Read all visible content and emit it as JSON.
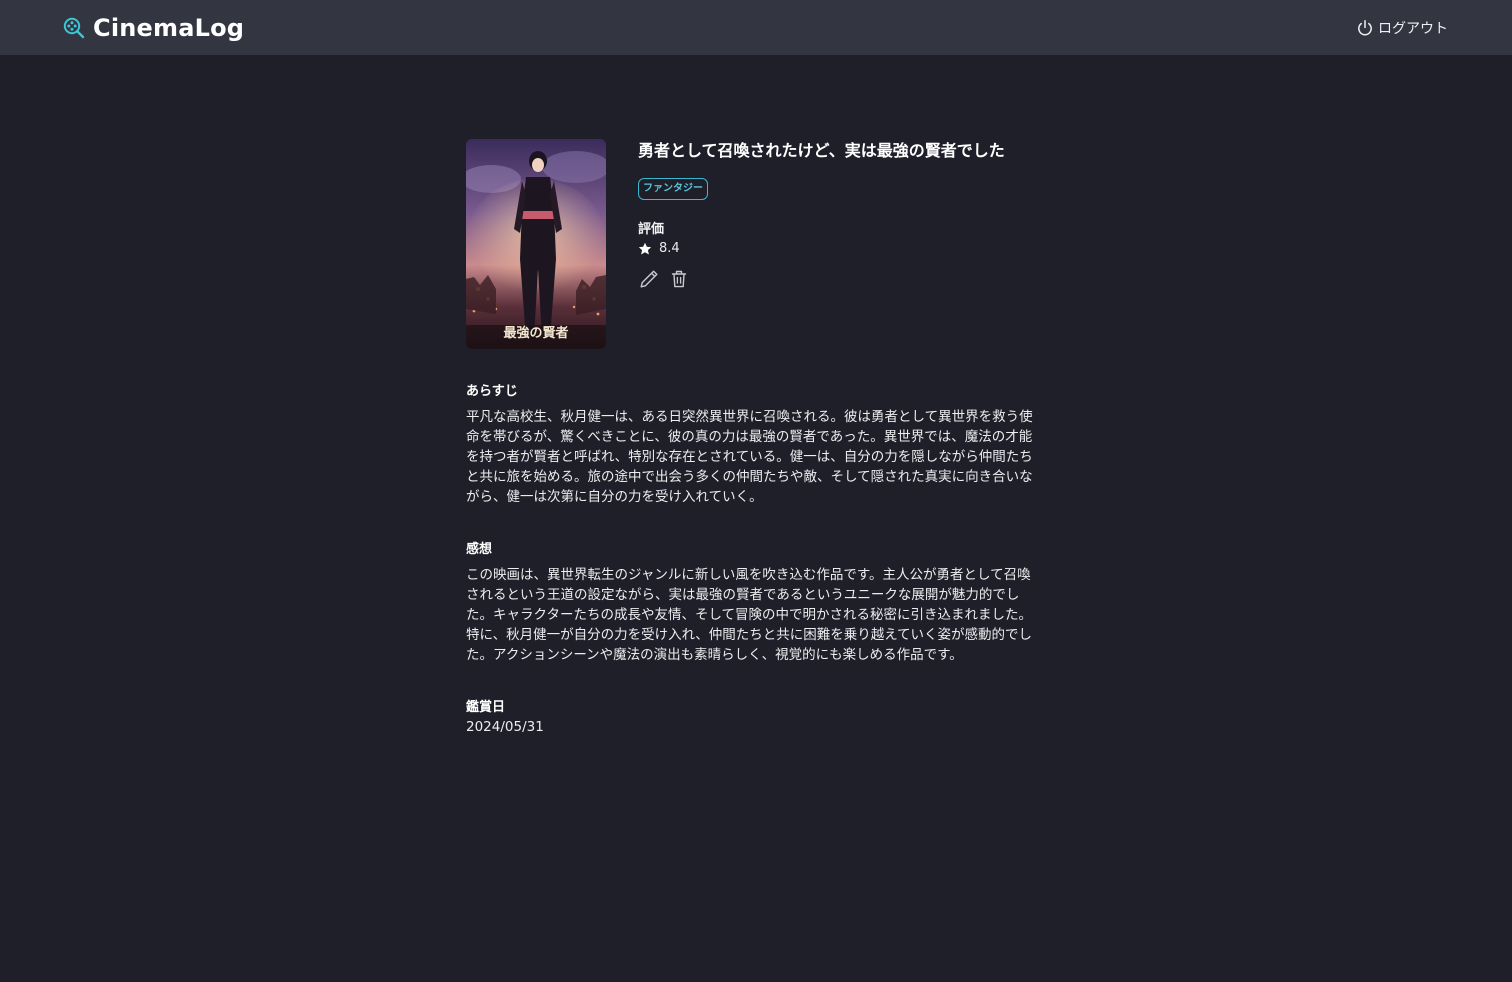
{
  "header": {
    "brand": "CinemaLog",
    "logout_label": "ログアウト",
    "icons": {
      "brand": "film-search-icon",
      "logout": "power-icon"
    },
    "accent_color": "#3bb6cf"
  },
  "movie": {
    "title": "勇者として召喚されたけど、実は最強の賢者でした",
    "genre": "ファンタジー",
    "poster_caption": "最強の賢者",
    "rating_label": "評価",
    "rating_value": "8.4",
    "actions": {
      "edit_icon": "pencil-icon",
      "delete_icon": "trash-icon"
    }
  },
  "synopsis": {
    "label": "あらすじ",
    "text": "平凡な高校生、秋月健一は、ある日突然異世界に召喚される。彼は勇者として異世界を救う使命を帯びるが、驚くべきことに、彼の真の力は最強の賢者であった。異世界では、魔法の才能を持つ者が賢者と呼ばれ、特別な存在とされている。健一は、自分の力を隠しながら仲間たちと共に旅を始める。旅の途中で出会う多くの仲間たちや敵、そして隠された真実に向き合いながら、健一は次第に自分の力を受け入れていく。"
  },
  "review": {
    "label": "感想",
    "text": "この映画は、異世界転生のジャンルに新しい風を吹き込む作品です。主人公が勇者として召喚されるという王道の設定ながら、実は最強の賢者であるというユニークな展開が魅力的でした。キャラクターたちの成長や友情、そして冒険の中で明かされる秘密に引き込まれました。特に、秋月健一が自分の力を受け入れ、仲間たちと共に困難を乗り越えていく姿が感動的でした。アクションシーンや魔法の演出も素晴らしく、視覚的にも楽しめる作品です。"
  },
  "watched": {
    "label": "鑑賞日",
    "date": "2024/05/31"
  }
}
